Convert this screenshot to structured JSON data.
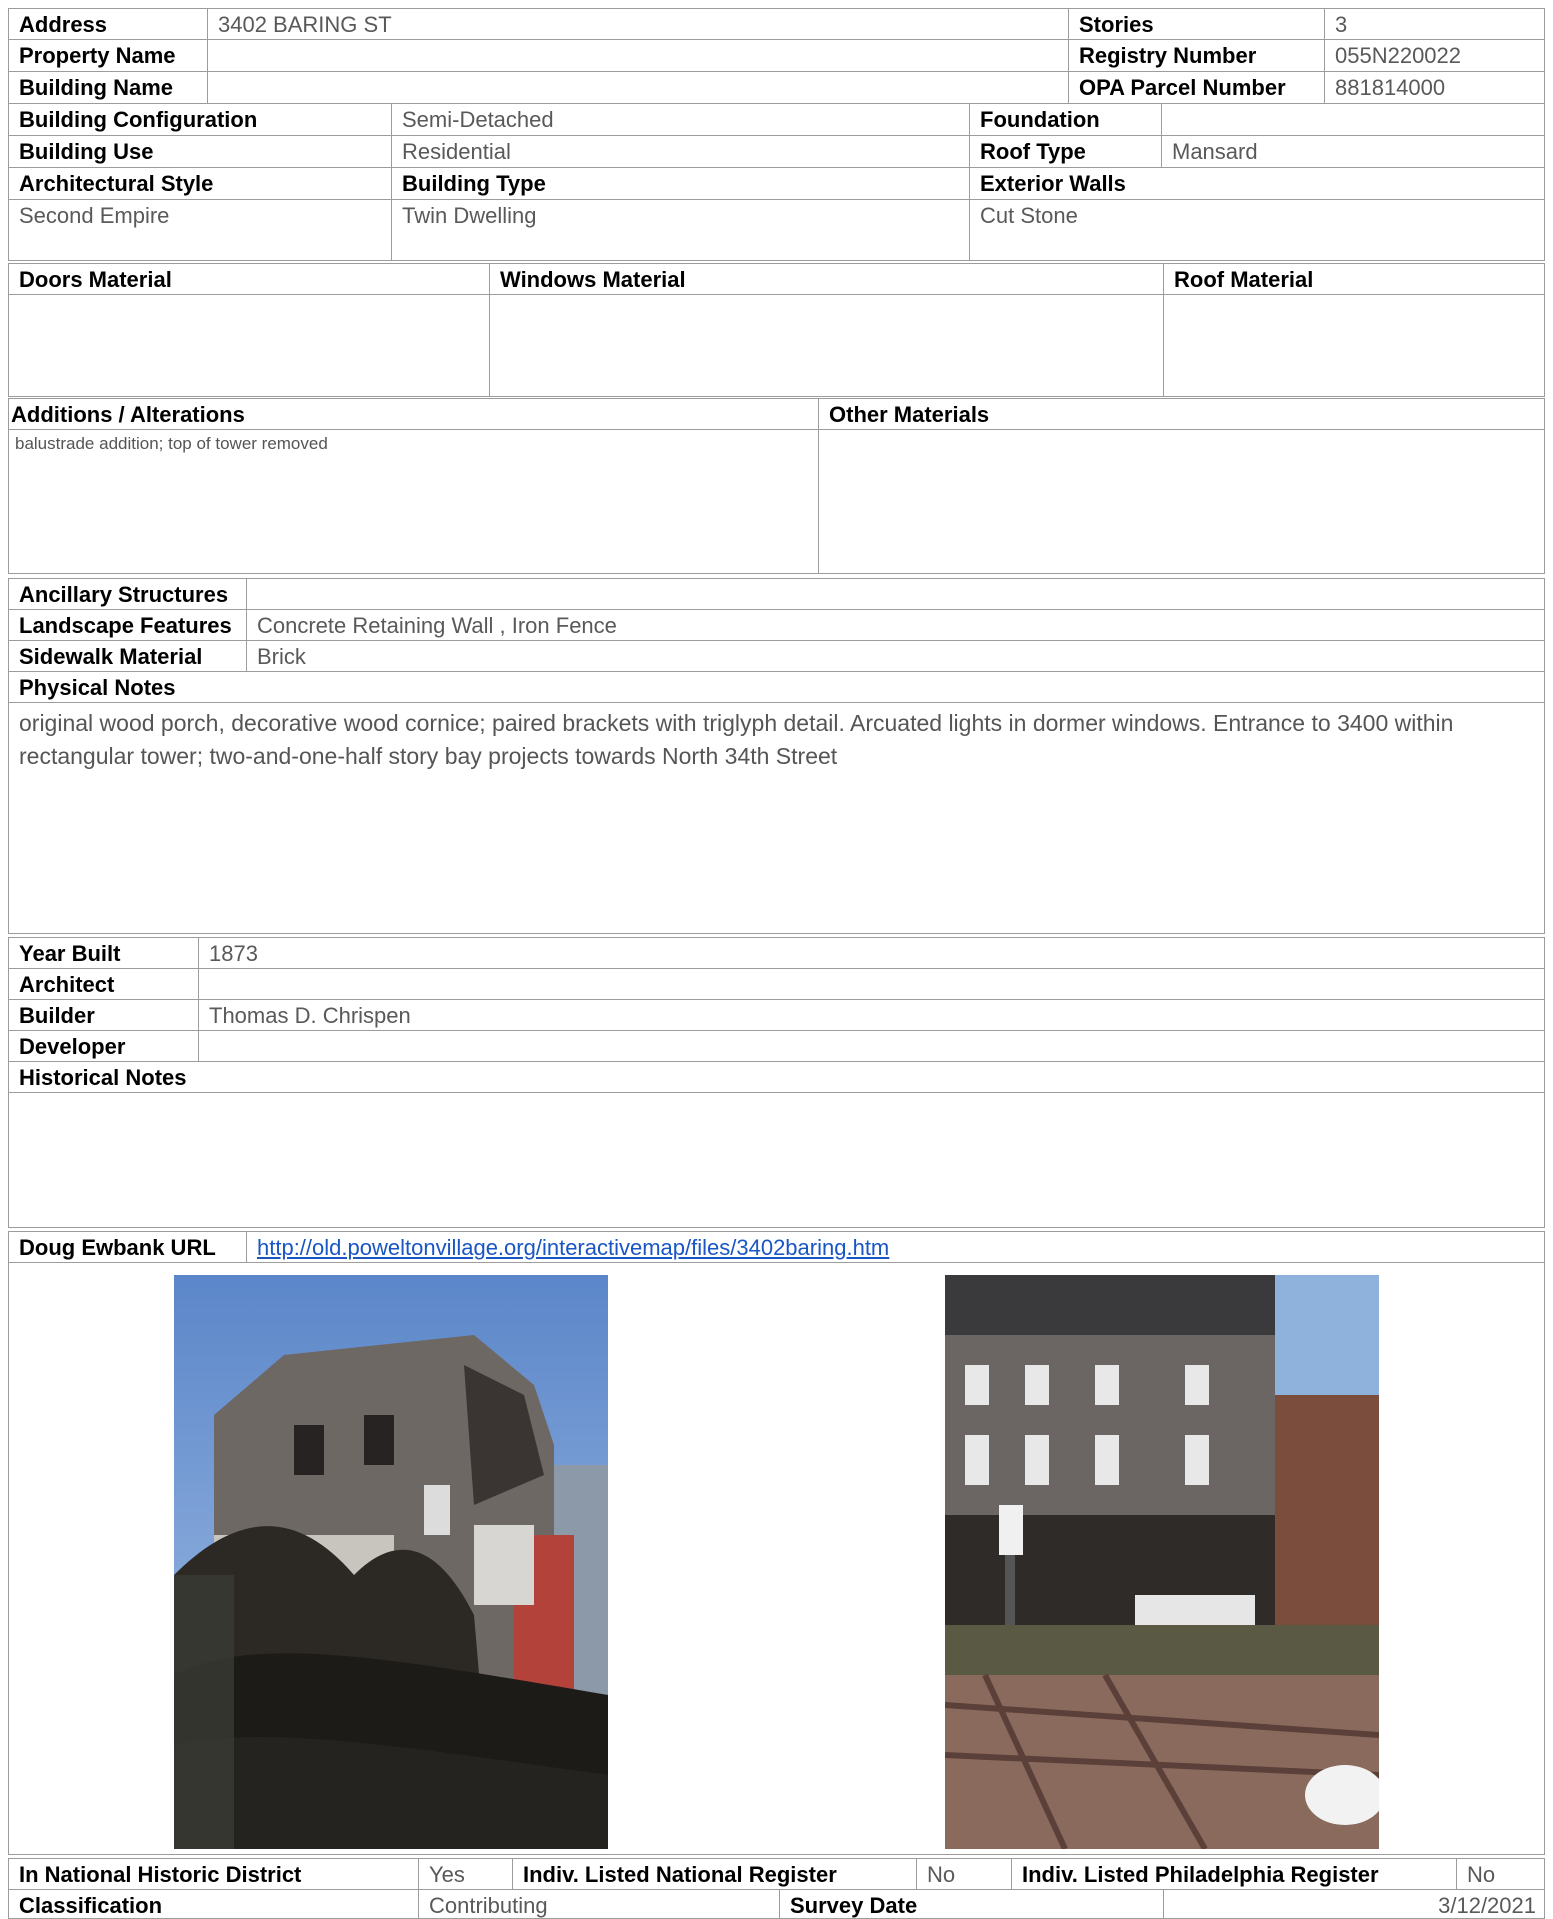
{
  "header": {
    "address_label": "Address",
    "address": "3402 BARING ST",
    "property_name_label": "Property Name",
    "property_name": "",
    "building_name_label": "Building Name",
    "building_name": "",
    "stories_label": "Stories",
    "stories": "3",
    "registry_label": "Registry Number",
    "registry": "055N220022",
    "opa_label": "OPA Parcel Number",
    "opa": "881814000"
  },
  "building": {
    "config_label": "Building Configuration",
    "config": "Semi-Detached",
    "use_label": "Building Use",
    "use": "Residential",
    "style_label": "Architectural Style",
    "style": "Second Empire",
    "type_label": "Building Type",
    "type": "Twin Dwelling",
    "foundation_label": "Foundation",
    "foundation": "",
    "roof_type_label": "Roof Type",
    "roof_type": "Mansard",
    "exterior_label": "Exterior Walls",
    "exterior": "Cut Stone"
  },
  "materials": {
    "doors_label": "Doors Material",
    "doors": "",
    "windows_label": "Windows Material",
    "windows": "",
    "roof_label": "Roof Material",
    "roof": ""
  },
  "alterations": {
    "label": "Additions / Alterations",
    "value": "balustrade addition; top of tower removed",
    "other_label": "Other Materials",
    "other": ""
  },
  "site": {
    "ancillary_label": "Ancillary Structures",
    "ancillary": "",
    "landscape_label": "Landscape Features",
    "landscape": "Concrete Retaining Wall , Iron Fence",
    "sidewalk_label": "Sidewalk Material",
    "sidewalk": "Brick",
    "physical_label": "Physical Notes",
    "physical": "original wood porch, decorative wood cornice; paired brackets with triglyph detail. Arcuated lights in dormer windows. Entrance to 3400 within rectangular tower; two-and-one-half story bay projects towards North 34th Street"
  },
  "history": {
    "year_label": "Year Built",
    "year": "1873",
    "architect_label": "Architect",
    "architect": "",
    "builder_label": "Builder",
    "builder": "Thomas D. Chrispen",
    "developer_label": "Developer",
    "developer": "",
    "notes_label": "Historical Notes",
    "notes": "",
    "url_label": "Doug Ewbank URL",
    "url": "http://old.poweltonvillage.org/interactivemap/files/3402baring.htm"
  },
  "status": {
    "district_label": "In National Historic District",
    "district": "Yes",
    "national_label": "Indiv. Listed National Register",
    "national": "No",
    "phila_label": "Indiv. Listed Philadelphia Register",
    "phila": "No",
    "class_label": "Classification",
    "class": "Contributing",
    "survey_label": "Survey Date",
    "survey": "3/12/2021"
  },
  "colors": {
    "label": "#000000",
    "value": "#595959",
    "border": "#9c9c9c",
    "link": "#1a55c4"
  }
}
